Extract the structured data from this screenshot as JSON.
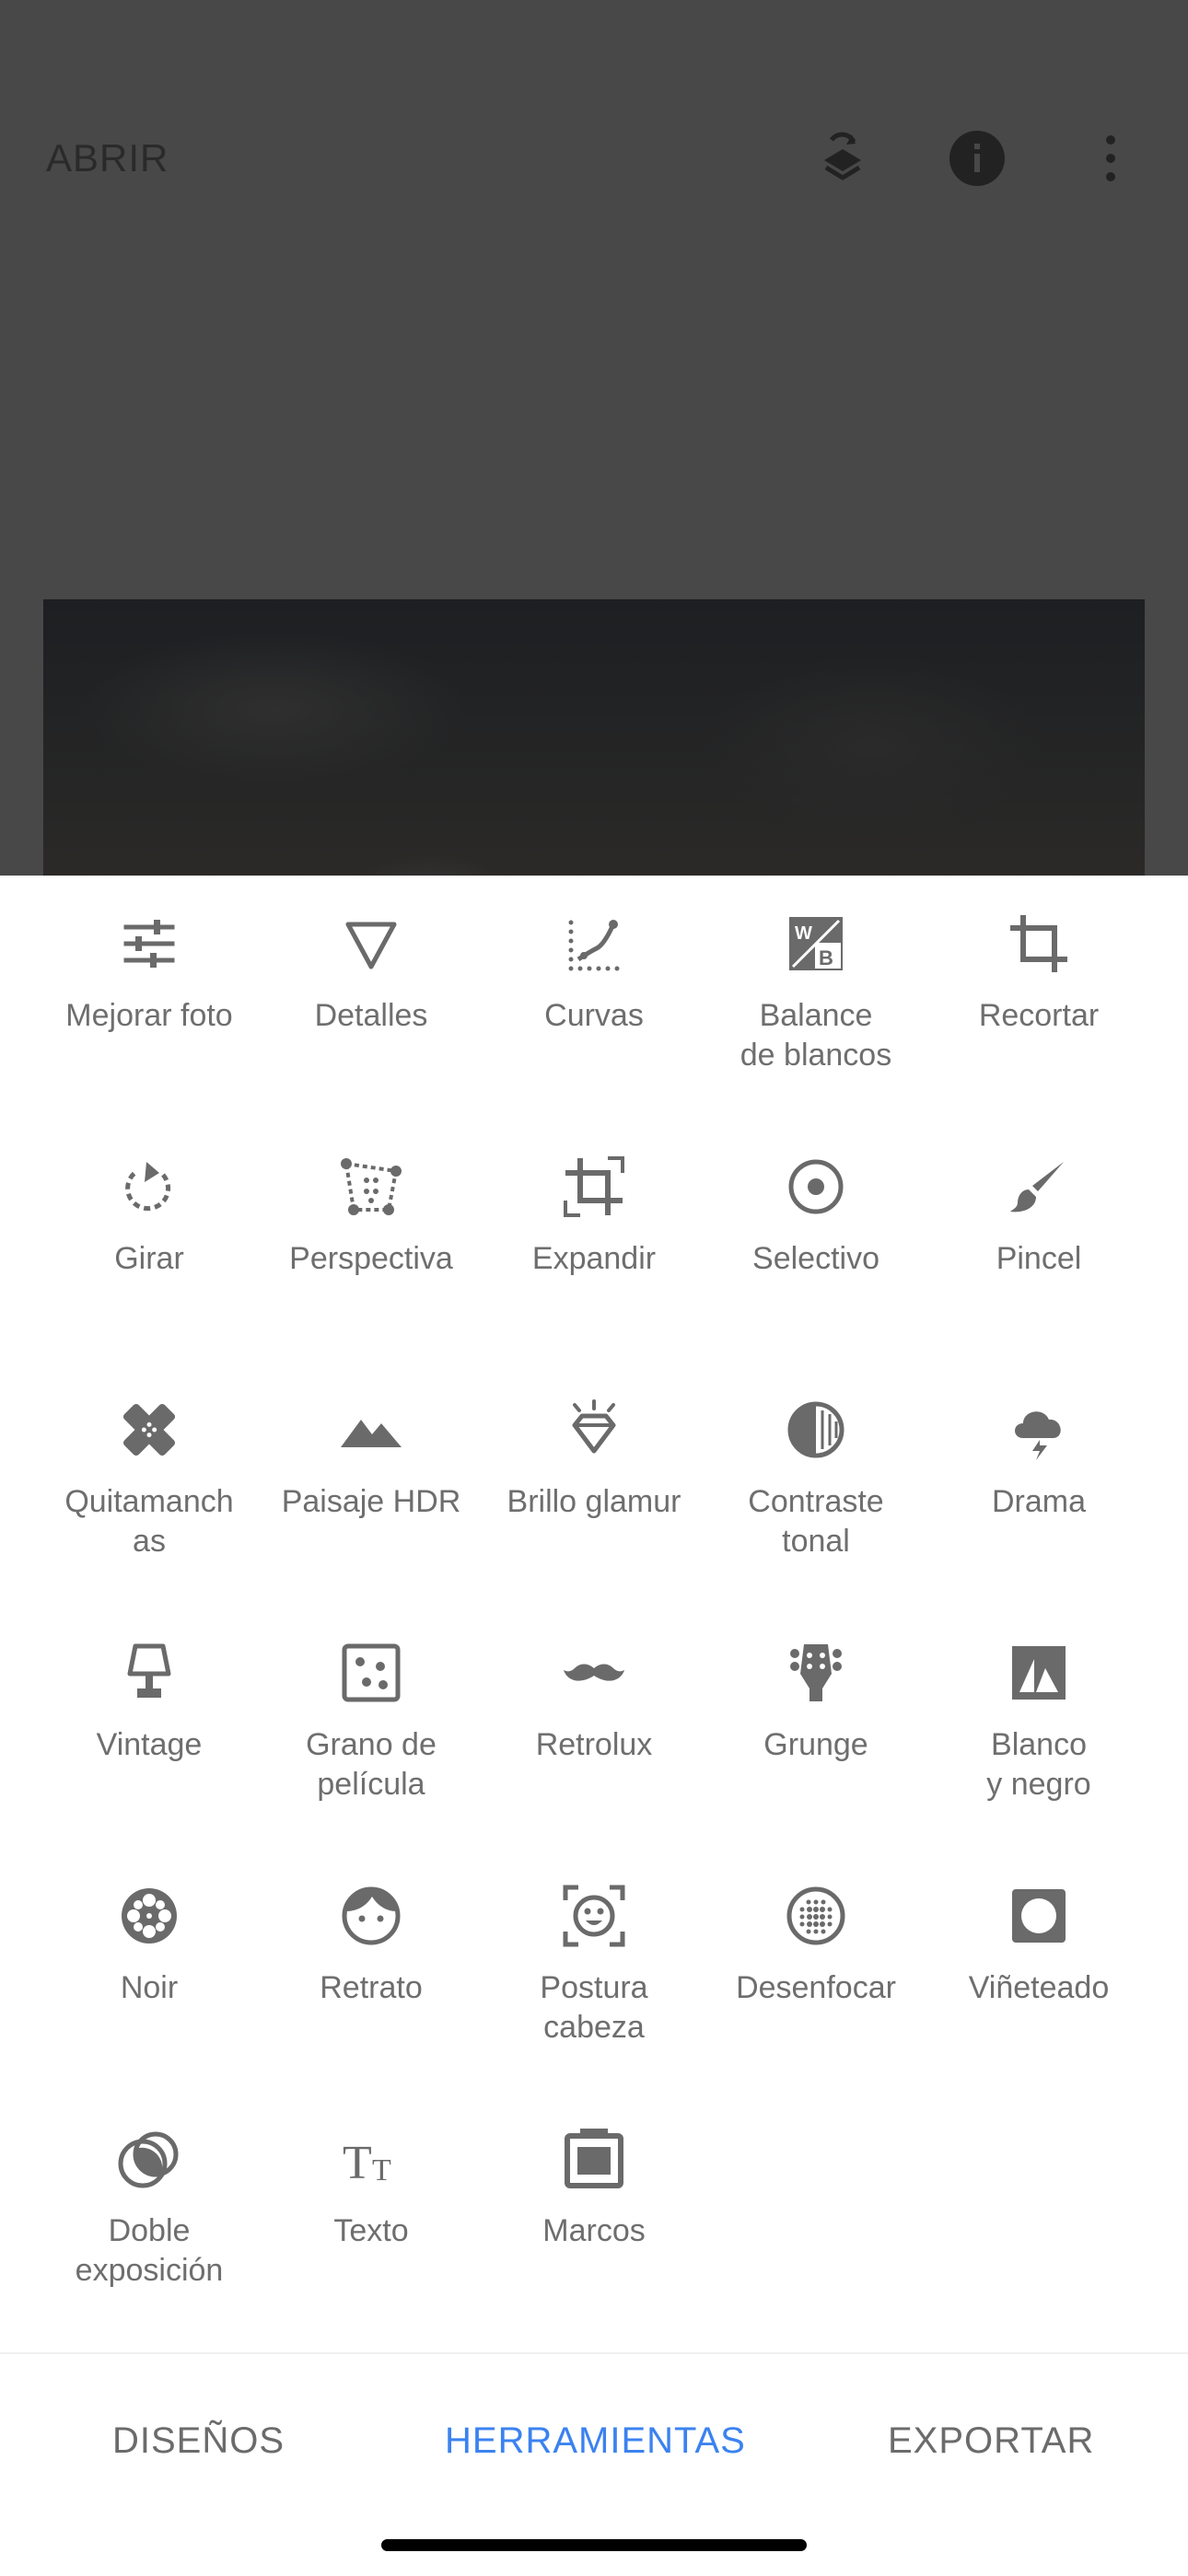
{
  "header": {
    "open_label": "ABRIR",
    "icons": [
      "layers-history-icon",
      "info-icon",
      "more-vertical-icon"
    ]
  },
  "tools": [
    {
      "label": "Mejorar foto",
      "icon": "tune-sliders-icon"
    },
    {
      "label": "Detalles",
      "icon": "triangle-details-icon"
    },
    {
      "label": "Curvas",
      "icon": "curves-icon"
    },
    {
      "label": "Balance\nde blancos",
      "icon": "white-balance-icon"
    },
    {
      "label": "Recortar",
      "icon": "crop-icon"
    },
    {
      "label": "Girar",
      "icon": "rotate-icon"
    },
    {
      "label": "Perspectiva",
      "icon": "perspective-icon"
    },
    {
      "label": "Expandir",
      "icon": "expand-icon"
    },
    {
      "label": "Selectivo",
      "icon": "selective-icon"
    },
    {
      "label": "Pincel",
      "icon": "brush-icon"
    },
    {
      "label": "Quitamanch\nas",
      "icon": "healing-bandage-icon"
    },
    {
      "label": "Paisaje HDR",
      "icon": "mountains-icon"
    },
    {
      "label": "Brillo glamur",
      "icon": "diamond-glow-icon"
    },
    {
      "label": "Contraste\ntonal",
      "icon": "tonal-contrast-icon"
    },
    {
      "label": "Drama",
      "icon": "storm-cloud-icon"
    },
    {
      "label": "Vintage",
      "icon": "lamp-icon"
    },
    {
      "label": "Grano de\npelícula",
      "icon": "film-grain-icon"
    },
    {
      "label": "Retrolux",
      "icon": "mustache-icon"
    },
    {
      "label": "Grunge",
      "icon": "guitar-head-icon"
    },
    {
      "label": "Blanco\ny negro",
      "icon": "black-white-icon"
    },
    {
      "label": "Noir",
      "icon": "film-reel-icon"
    },
    {
      "label": "Retrato",
      "icon": "face-icon"
    },
    {
      "label": "Postura\ncabeza",
      "icon": "head-pose-icon"
    },
    {
      "label": "Desenfocar",
      "icon": "blur-icon"
    },
    {
      "label": "Viñeteado",
      "icon": "vignette-icon"
    },
    {
      "label": "Doble\nexposición",
      "icon": "double-exposure-icon"
    },
    {
      "label": "Texto",
      "icon": "text-icon"
    },
    {
      "label": "Marcos",
      "icon": "frame-icon"
    }
  ],
  "nav": {
    "items": [
      "DISEÑOS",
      "HERRAMIENTAS",
      "EXPORTAR"
    ],
    "active": "HERRAMIENTAS",
    "accent_color": "#3b82f0"
  }
}
